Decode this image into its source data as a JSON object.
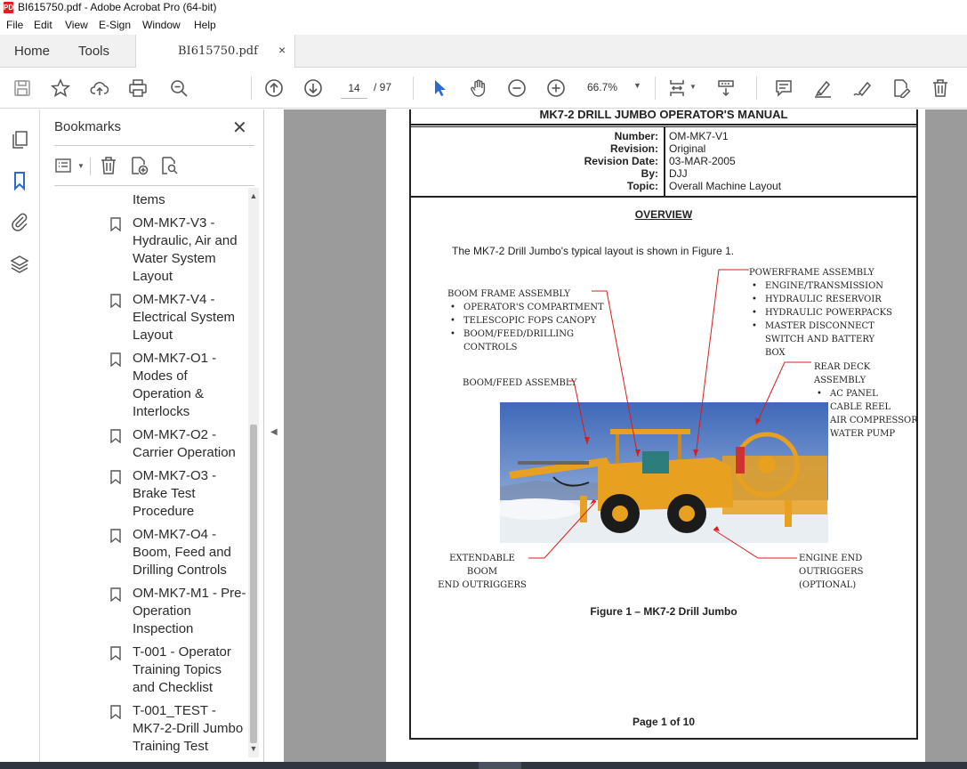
{
  "window": {
    "title": "BI615750.pdf - Adobe Acrobat Pro (64-bit)",
    "icon_label": "PDF"
  },
  "menu": [
    "File",
    "Edit",
    "View",
    "E-Sign",
    "Window",
    "Help"
  ],
  "tabs": {
    "home": "Home",
    "tools": "Tools",
    "document": "BI615750.pdf",
    "close": "×"
  },
  "toolbar": {
    "page_current": "14",
    "page_total": "/ 97",
    "zoom": "66.7%",
    "zoom_caret": "▼"
  },
  "bookmarks": {
    "title": "Bookmarks",
    "close": "✕",
    "items": [
      {
        "label": "Items"
      },
      {
        "label": "OM-MK7-V3 - Hydraulic, Air and Water System Layout"
      },
      {
        "label": "OM-MK7-V4 - Electrical System Layout"
      },
      {
        "label": "OM-MK7-O1 - Modes of Operation & Interlocks"
      },
      {
        "label": "OM-MK7-O2 - Carrier Operation"
      },
      {
        "label": "OM-MK7-O3 - Brake Test Procedure"
      },
      {
        "label": "OM-MK7-O4 - Boom, Feed and Drilling Controls"
      },
      {
        "label": "OM-MK7-M1 - Pre-Operation Inspection"
      },
      {
        "label": "T-001 - Operator Training Topics and Checklist"
      },
      {
        "label": "T-001_TEST - MK7-2-Drill Jumbo Training Test"
      }
    ]
  },
  "document": {
    "header": "MK7-2 DRILL JUMBO OPERATOR'S MANUAL",
    "meta": [
      {
        "key": "Number:",
        "value": "OM-MK7-V1"
      },
      {
        "key": "Revision:",
        "value": "Original"
      },
      {
        "key": "Revision Date:",
        "value": "03-MAR-2005"
      },
      {
        "key": "By:",
        "value": "DJJ"
      },
      {
        "key": "Topic:",
        "value": "Overall Machine Layout"
      }
    ],
    "overview_heading": "OVERVIEW",
    "intro": "The MK7-2 Drill Jumbo's typical layout is shown in Figure 1.",
    "labels": {
      "boom_frame": {
        "title": "BOOM FRAME ASSEMBLY",
        "items": [
          "OPERATOR'S COMPARTMENT",
          "TELESCOPIC FOPS CANOPY",
          "BOOM/FEED/DRILLING CONTROLS"
        ]
      },
      "powerframe": {
        "title": "POWERFRAME ASSEMBLY",
        "items": [
          "ENGINE/TRANSMISSION",
          "HYDRAULIC RESERVOIR",
          "HYDRAULIC POWERPACKS",
          "MASTER DISCONNECT SWITCH AND BATTERY BOX"
        ]
      },
      "boom_feed": "BOOM/FEED ASSEMBLY",
      "rear_deck": {
        "title": "REAR DECK ASSEMBLY",
        "items": [
          "AC PANEL",
          "CABLE REEL",
          "AIR COMPRESSOR",
          "WATER PUMP"
        ]
      },
      "extendable_1": "EXTENDABLE BOOM",
      "extendable_2": "END OUTRIGGERS",
      "engine_end_1": "ENGINE END OUTRIGGERS",
      "engine_end_2": "(OPTIONAL)"
    },
    "caption": "Figure 1 – MK7-2 Drill Jumbo",
    "page_footer": "Page 1 of 10"
  },
  "colors": {
    "accent": "#2a6bd1",
    "page_bg": "#9b9b9b",
    "machine": "#e8a020"
  }
}
